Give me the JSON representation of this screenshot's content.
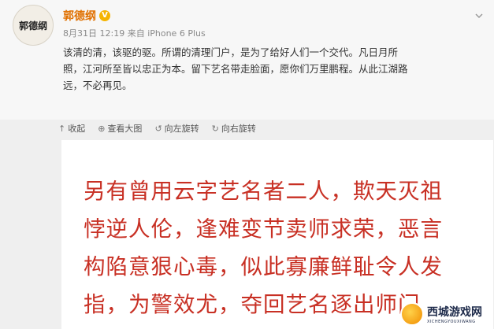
{
  "post": {
    "avatar_text": "郭德纲",
    "author_name": "郭德纲",
    "verified_badge": "V",
    "date": "8月31日",
    "time": "12:19",
    "source": "来自 iPhone 6 Plus",
    "text_line_1": "该清的清，该驱的驱。所谓的清理门户，是为了给好人们一个交代。凡日月所",
    "text_line_2": "照，江河所至皆以忠正为本。留下艺名带走脸面，愿你们万里鹏程。从此江湖路",
    "text_line_3": "远，不必再见。"
  },
  "image_toolbar": {
    "collapse_label": "收起",
    "view_large_label": "查看大图",
    "rotate_left_label": "向左旋转",
    "rotate_right_label": "向右旋转"
  },
  "document_image": {
    "line_1": "另有曾用云字艺名者二人，欺天灭祖",
    "line_2": "悖逆人伦，逢难变节卖师求荣，恶言",
    "line_3": "构陷意狠心毒，似此寡廉鲜耻令人发",
    "line_4": "指，为警效尤，夺回艺名逐出师门"
  },
  "watermark": {
    "title": "西城游戏网",
    "subtitle": "XICHENGYOUXIWANG"
  },
  "colors": {
    "author_name": "#e07000",
    "doc_text": "#c83024",
    "verified_badge": "#f5b400"
  },
  "icons": {
    "collapse": "arrow-up-icon",
    "view_large": "zoom-icon",
    "rotate_left": "rotate-left-icon",
    "rotate_right": "rotate-right-icon",
    "dropdown": "chevron-down-icon"
  }
}
